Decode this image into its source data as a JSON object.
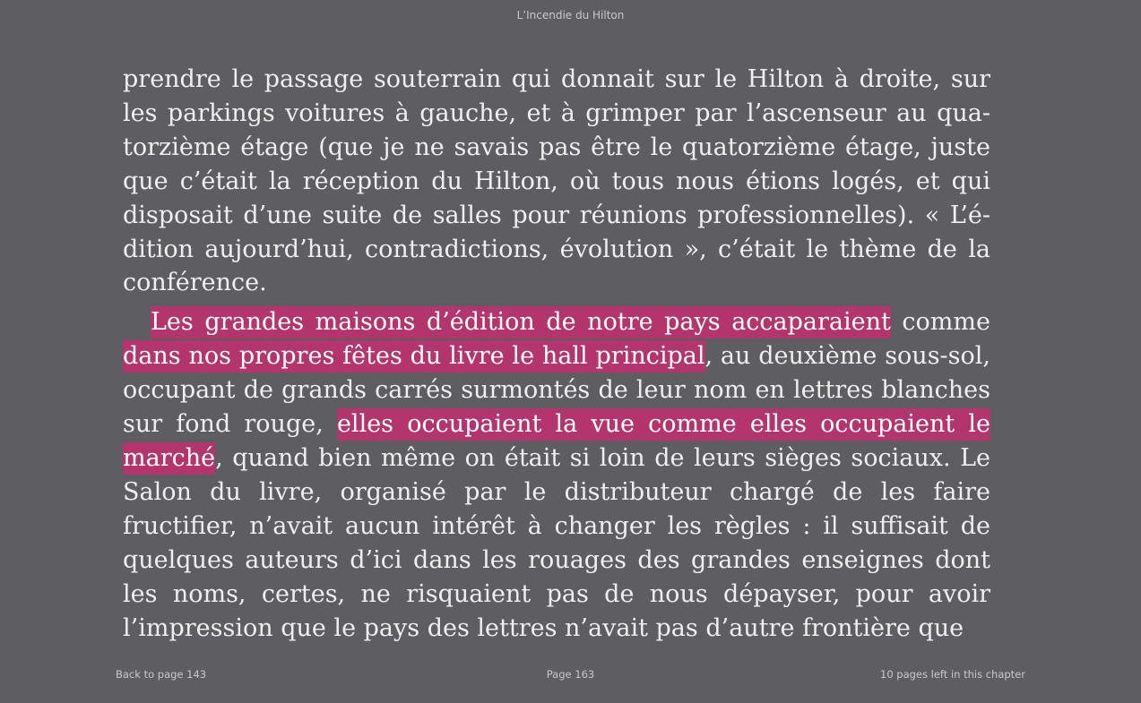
{
  "window": {
    "title": "L’Incendie du Hilton"
  },
  "page": {
    "paragraph1": "prendre le passage souterrain qui donnait sur le Hilton à droite, sur les parkings voitures à gauche, et à grimper par l’ascenseur au qua­torzième étage (que je ne savais pas être le quatorzième étage, juste que c’était la réception du Hilton, où tous nous étions logés, et qui disposait d’une suite de salles pour réunions professionnelles). « L’é­dition aujourd’hui, contradictions, évolution », c’était le thème de la conférence.",
    "paragraph2": {
      "highlight1": "Les grandes maisons d’édition de notre pays accaparaient",
      "text1": " comme ",
      "highlight2": "dans nos propres fêtes du livre le hall principal",
      "text2": ", au deuxième sous-sol, occupant de grands carrés surmontés de leur nom en lettres blanches sur fond rouge, ",
      "highlight3": "elles occupaient la vue comme elles occu­paient le marché",
      "text3": ", quand bien même on était si loin de leurs sièges sociaux. Le Salon du livre, organisé par le distributeur chargé de les faire fructifier, n’avait aucun intérêt à changer les règles : il suffisait de quelques auteurs d’ici dans les rouages des grandes enseignes dont les noms, certes, ne risquaient pas de nous dépayser, pour avoir l’impression que le pays des lettres n’avait pas d’autre frontière que"
    }
  },
  "footer": {
    "back_link": "Back to page 143",
    "page_number": "Page 163",
    "pages_left": "10 pages left in this chapter"
  },
  "colors": {
    "background": "#5e5d62",
    "text": "#efeef0",
    "highlight": "#b2356d",
    "chrome_text": "#c9c8cc"
  }
}
